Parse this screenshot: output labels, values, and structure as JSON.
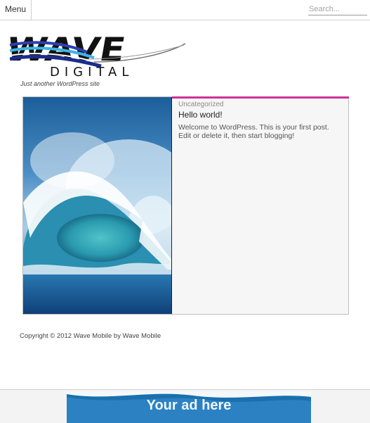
{
  "topbar": {
    "menu_label": "Menu",
    "search_placeholder": "Search..."
  },
  "site": {
    "logo_word": "WAVE",
    "logo_subword": "DIGITAL",
    "tagline": "Just another WordPress site"
  },
  "post": {
    "category": "Uncategorized",
    "title": "Hello world!",
    "excerpt": "Welcome to WordPress. This is your first post. Edit or delete it, then start blogging!",
    "image_icon": "ocean-wave-image"
  },
  "footer": {
    "copyright": "Copyright © 2012 Wave Mobile by Wave Mobile"
  },
  "ad": {
    "text": "Your ad here"
  },
  "colors": {
    "accent": "#cc3399",
    "ad_blue": "#1a6fae",
    "logo_blue": "#1b2d8c"
  }
}
